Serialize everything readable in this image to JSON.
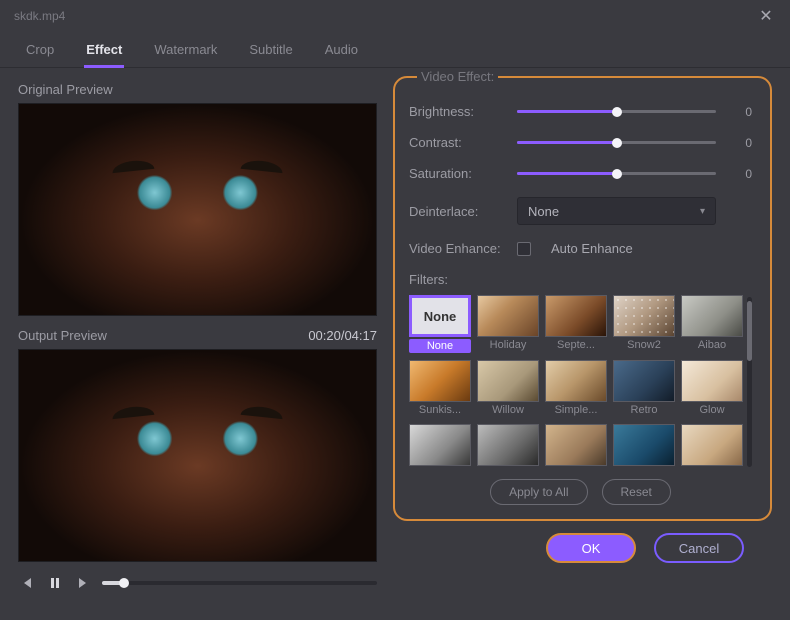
{
  "window": {
    "title": "skdk.mp4"
  },
  "tabs": {
    "crop": "Crop",
    "effect": "Effect",
    "watermark": "Watermark",
    "subtitle": "Subtitle",
    "audio": "Audio",
    "active": "effect"
  },
  "previews": {
    "original_label": "Original Preview",
    "output_label": "Output Preview",
    "timecode": "00:20/04:17"
  },
  "transport": {
    "progress_pct": 8
  },
  "panel": {
    "title": "Video Effect:",
    "brightness": {
      "label": "Brightness:",
      "value": 0,
      "pct": 50
    },
    "contrast": {
      "label": "Contrast:",
      "value": 0,
      "pct": 50
    },
    "saturation": {
      "label": "Saturation:",
      "value": 0,
      "pct": 50
    },
    "deinterlace": {
      "label": "Deinterlace:",
      "selected": "None"
    },
    "enhance": {
      "label": "Video Enhance:",
      "checkbox_label": "Auto Enhance",
      "checked": false
    },
    "filters_label": "Filters:",
    "filters": [
      {
        "name": "None",
        "class": "none-thumb",
        "selected": true
      },
      {
        "name": "Holiday",
        "class": "f-holiday"
      },
      {
        "name": "Septe...",
        "class": "f-septe"
      },
      {
        "name": "Snow2",
        "class": "f-snow2"
      },
      {
        "name": "Aibao",
        "class": "f-aibao"
      },
      {
        "name": "Sunkis...",
        "class": "f-sunkis"
      },
      {
        "name": "Willow",
        "class": "f-willow"
      },
      {
        "name": "Simple...",
        "class": "f-simple"
      },
      {
        "name": "Retro",
        "class": "f-retro"
      },
      {
        "name": "Glow",
        "class": "f-glow"
      },
      {
        "name": "",
        "class": "f-r3a"
      },
      {
        "name": "",
        "class": "f-r3b"
      },
      {
        "name": "",
        "class": "f-r3c"
      },
      {
        "name": "",
        "class": "f-r3d"
      },
      {
        "name": "",
        "class": "f-r3e"
      }
    ],
    "apply_all": "Apply to All",
    "reset": "Reset"
  },
  "dialog": {
    "ok": "OK",
    "cancel": "Cancel"
  }
}
